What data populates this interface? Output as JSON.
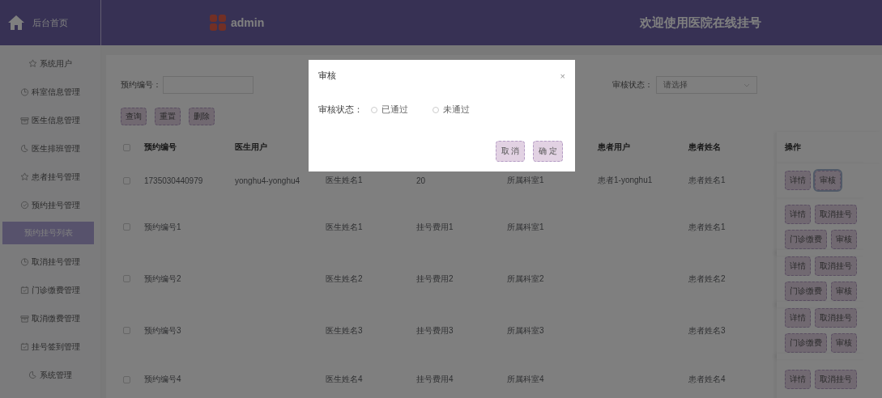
{
  "header": {
    "home_label": "后台首页",
    "brand": "admin",
    "welcome": "欢迎使用医院在线挂号"
  },
  "sidebar": {
    "items": [
      {
        "label": "系统用户",
        "kind": "star",
        "selected": false
      },
      {
        "label": "科室信息管理",
        "kind": "clock",
        "selected": false
      },
      {
        "label": "医生信息管理",
        "kind": "box",
        "selected": false
      },
      {
        "label": "医生排班管理",
        "kind": "pie",
        "selected": false
      },
      {
        "label": "患者挂号管理",
        "kind": "star",
        "selected": false
      },
      {
        "label": "预约挂号管理",
        "kind": "check",
        "selected": false
      },
      {
        "label": "预约挂号列表",
        "kind": "plain",
        "selected": true
      },
      {
        "label": "取消挂号管理",
        "kind": "clock",
        "selected": false
      },
      {
        "label": "门诊缴费管理",
        "kind": "calendar",
        "selected": false
      },
      {
        "label": "取消缴费管理",
        "kind": "box",
        "selected": false
      },
      {
        "label": "挂号签到管理",
        "kind": "calendar",
        "selected": false
      },
      {
        "label": "系统管理",
        "kind": "pie",
        "selected": false
      }
    ]
  },
  "search": {
    "fields": [
      {
        "kind": "input",
        "label": "预约编号："
      },
      {
        "kind": "select",
        "label": "审核状态：",
        "placeholder": "请选择"
      }
    ],
    "buttons": [
      "查询",
      "重置",
      "删除"
    ]
  },
  "table": {
    "all_checked": false,
    "columns": [
      "预约编号",
      "医生用户",
      null,
      null,
      null,
      "患者用户",
      "患者姓名"
    ],
    "actions_column": "操作",
    "rows": [
      {
        "checked": false,
        "cells": [
          "1735030440979",
          "yonghu4-yonghu4",
          "医生姓名1",
          "20",
          "所属科室1",
          "患者1-yonghu1",
          "患者姓名1"
        ],
        "actions": [
          {
            "label": "详情",
            "focused": false
          },
          {
            "label": "审核",
            "focused": true
          }
        ]
      },
      {
        "checked": false,
        "cells": [
          "预约编号1",
          null,
          "医生姓名1",
          "挂号费用1",
          "所属科室1",
          null,
          "患者姓名1"
        ],
        "actions": [
          {
            "label": "详情",
            "focused": false
          },
          {
            "label": "取消挂号",
            "focused": false
          },
          {
            "label": "门诊缴费",
            "focused": false
          },
          {
            "label": "审核",
            "focused": false
          }
        ]
      },
      {
        "checked": false,
        "cells": [
          "预约编号2",
          null,
          "医生姓名2",
          "挂号费用2",
          "所属科室2",
          null,
          "患者姓名2"
        ],
        "actions": [
          {
            "label": "详情",
            "focused": false
          },
          {
            "label": "取消挂号",
            "focused": false
          },
          {
            "label": "门诊缴费",
            "focused": false
          },
          {
            "label": "审核",
            "focused": false
          }
        ]
      },
      {
        "checked": false,
        "cells": [
          "预约编号3",
          null,
          "医生姓名3",
          "挂号费用3",
          "所属科室3",
          null,
          "患者姓名3"
        ],
        "actions": [
          {
            "label": "详情",
            "focused": false
          },
          {
            "label": "取消挂号",
            "focused": false
          },
          {
            "label": "门诊缴费",
            "focused": false
          },
          {
            "label": "审核",
            "focused": false
          }
        ]
      },
      {
        "checked": false,
        "cells": [
          "预约编号4",
          null,
          "医生姓名4",
          "挂号费用4",
          "所属科室4",
          null,
          "患者姓名4"
        ],
        "actions": [
          {
            "label": "详情",
            "focused": false
          },
          {
            "label": "取消挂号",
            "focused": false
          }
        ]
      }
    ]
  },
  "dialog": {
    "title": "审核",
    "close": "×",
    "field_label": "审核状态：",
    "options": [
      {
        "label": "已通过",
        "selected": false
      },
      {
        "label": "未通过",
        "selected": false
      }
    ],
    "buttons": [
      "取 消",
      "确 定"
    ]
  }
}
